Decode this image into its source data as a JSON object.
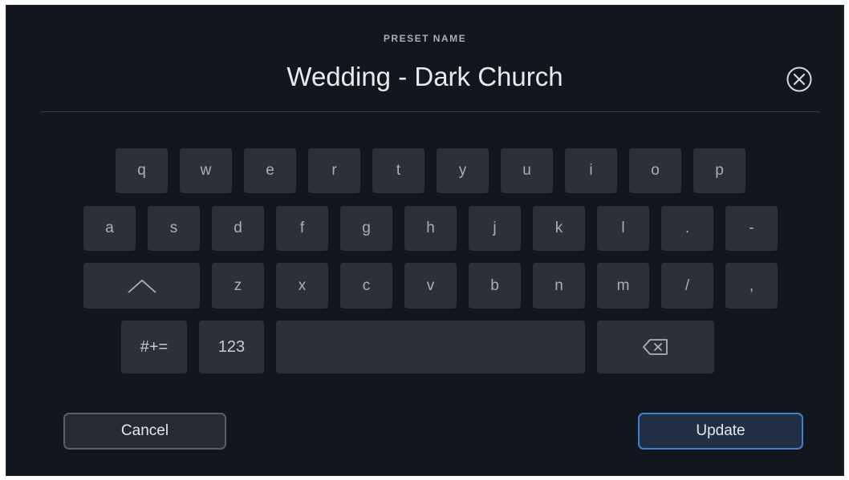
{
  "header": {
    "label": "PRESET NAME",
    "value": "Wedding - Dark Church"
  },
  "icons": {
    "clear": "close-circle-icon",
    "shift": "chevron-up-icon",
    "backspace": "backspace-icon"
  },
  "keyboard": {
    "row1": [
      "q",
      "w",
      "e",
      "r",
      "t",
      "y",
      "u",
      "i",
      "o",
      "p"
    ],
    "row2": [
      "a",
      "s",
      "d",
      "f",
      "g",
      "h",
      "j",
      "k",
      "l",
      ".",
      "-"
    ],
    "row3": [
      "z",
      "x",
      "c",
      "v",
      "b",
      "n",
      "m",
      "/",
      ","
    ],
    "symbols_label": "#+=",
    "numbers_label": "123"
  },
  "footer": {
    "cancel_label": "Cancel",
    "update_label": "Update"
  },
  "colors": {
    "background": "#12161d",
    "key": "#2c3139",
    "accent": "#3b83d6"
  }
}
